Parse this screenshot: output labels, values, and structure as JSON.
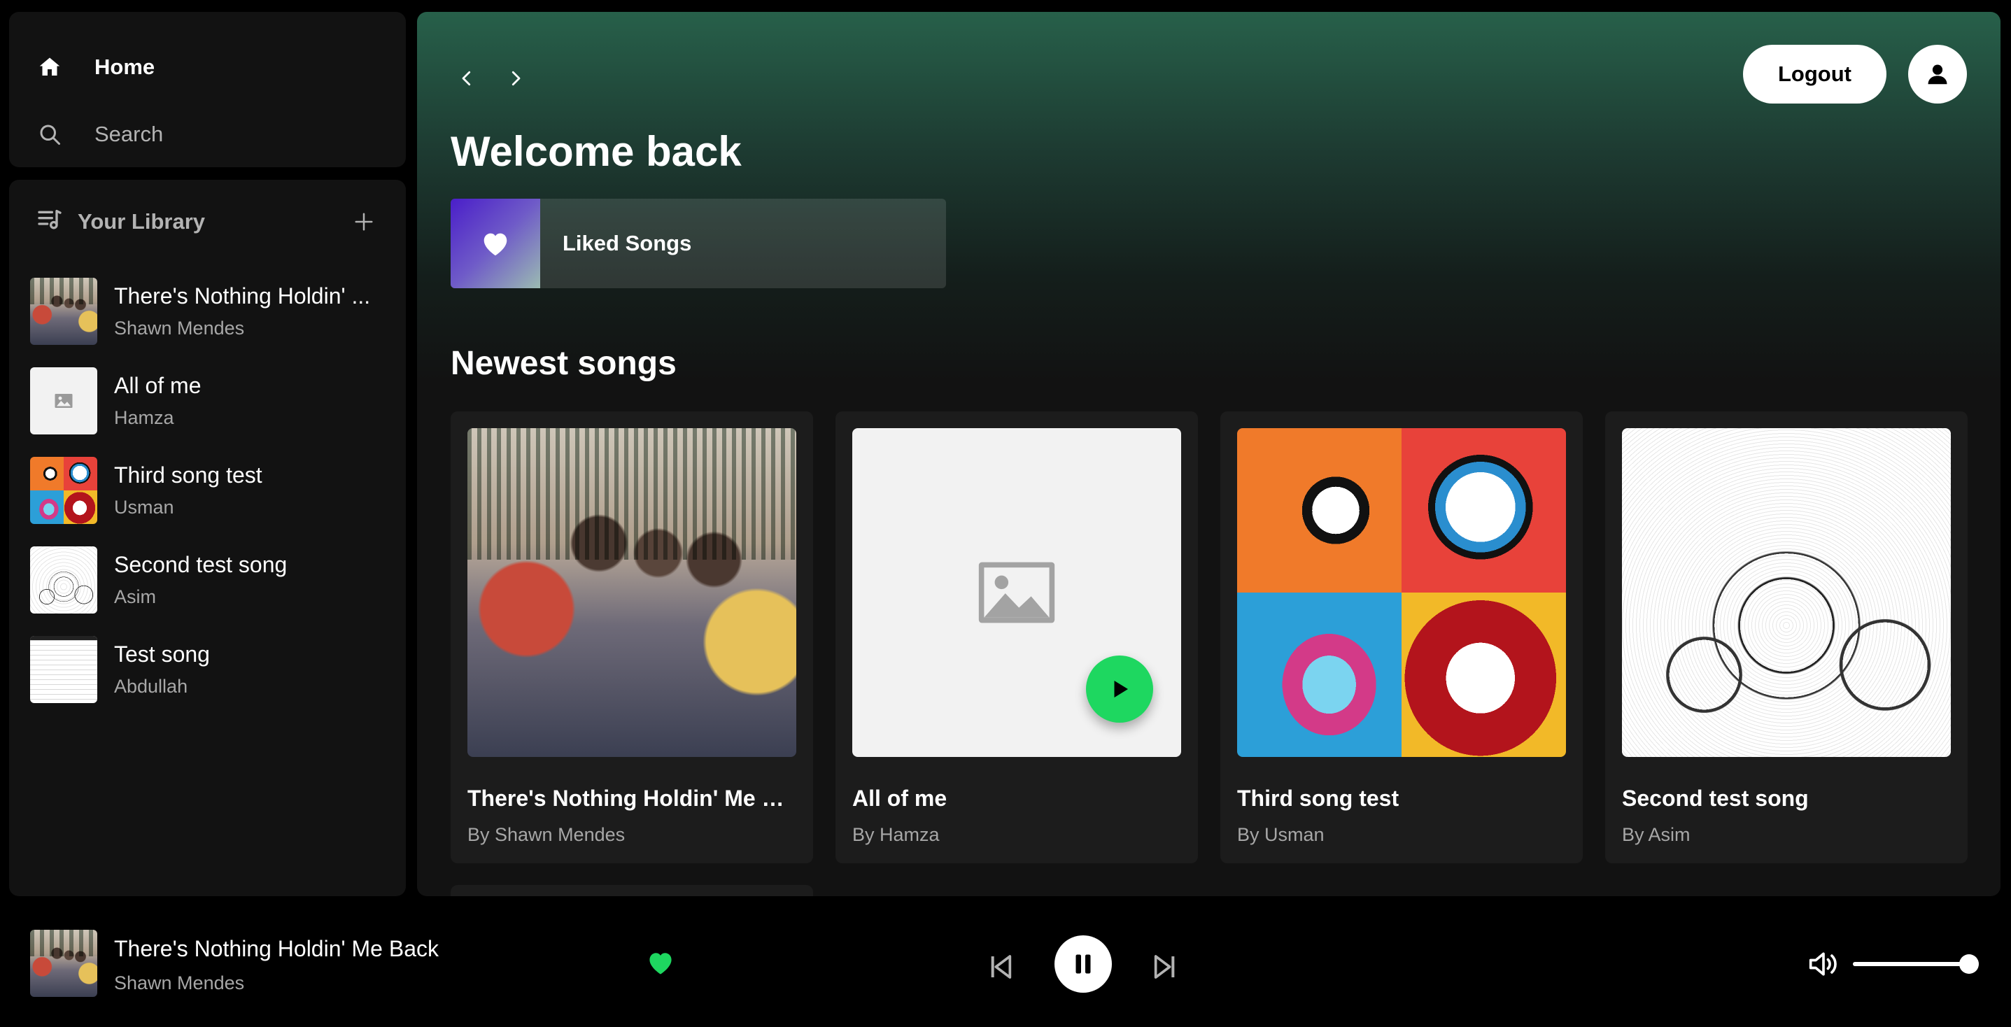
{
  "sidebar": {
    "nav": {
      "home_label": "Home",
      "search_label": "Search"
    },
    "library": {
      "title": "Your Library",
      "items": [
        {
          "title": "There's Nothing Holdin' ...",
          "artist": "Shawn Mendes",
          "art": "photo"
        },
        {
          "title": "All of me",
          "artist": "Hamza",
          "art": "blank"
        },
        {
          "title": "Third song test",
          "artist": "Usman",
          "art": "pop"
        },
        {
          "title": "Second test song",
          "artist": "Asim",
          "art": "sketch"
        },
        {
          "title": "Test song",
          "artist": "Abdullah",
          "art": "doc"
        }
      ]
    }
  },
  "header": {
    "logout_label": "Logout"
  },
  "main": {
    "greeting": "Welcome back",
    "liked_songs_label": "Liked Songs",
    "newest_title": "Newest songs",
    "cards": [
      {
        "title": "There's Nothing Holdin' Me Ba...",
        "by": "By Shawn Mendes",
        "art": "photo"
      },
      {
        "title": "All of me",
        "by": "By Hamza",
        "art": "blank"
      },
      {
        "title": "Third song test",
        "by": "By Usman",
        "art": "pop"
      },
      {
        "title": "Second test song",
        "by": "By Asim",
        "art": "sketch"
      }
    ]
  },
  "player": {
    "now_playing_title": "There's Nothing Holdin' Me Back",
    "now_playing_artist": "Shawn Mendes",
    "liked": true,
    "state": "playing",
    "volume": 1.0
  },
  "colors": {
    "accent": "#1ed760",
    "header_gradient_top": "#27604a",
    "panel": "#121212",
    "card": "#1c1c1c"
  },
  "icons": {
    "home": "home-icon",
    "search": "search-icon",
    "library": "library-icon",
    "add": "plus-icon",
    "back": "chevron-left-icon",
    "forward": "chevron-right-icon",
    "user": "user-icon",
    "heart": "heart-icon",
    "play": "play-icon",
    "pause": "pause-icon",
    "previous": "skip-previous-icon",
    "next": "skip-next-icon",
    "volume": "volume-icon",
    "image_placeholder": "image-placeholder-icon"
  }
}
